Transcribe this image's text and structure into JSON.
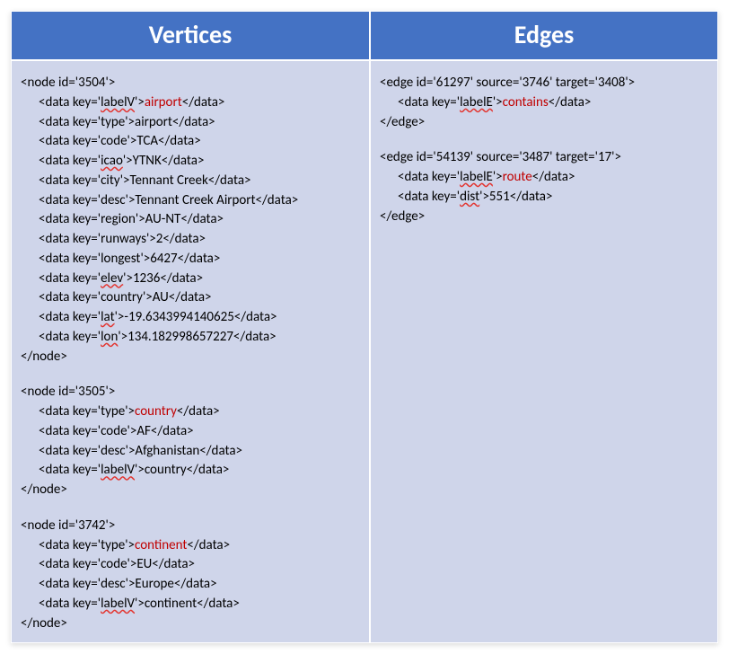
{
  "headers": {
    "vertices": "Vertices",
    "edges": "Edges"
  },
  "vertices": {
    "n1": {
      "open": "<node id='3504'>",
      "d_labelV_pre": "<data key='",
      "d_labelV_key": "labelV",
      "d_labelV_mid": "'>",
      "d_labelV_val": "airport",
      "d_labelV_end": "</data>",
      "d_type": "<data key='type'>airport</data>",
      "d_code": "<data key='code'>TCA</data>",
      "d_icao_pre": "<data key='",
      "d_icao_key": "icao",
      "d_icao_mid": "'>YTNK</data>",
      "d_city": "<data key='city'>Tennant Creek</data>",
      "d_desc": "<data key='desc'>Tennant Creek Airport</data>",
      "d_region": "<data key='region'>AU-NT</data>",
      "d_runways": "<data key='runways'>2</data>",
      "d_longest": "<data key='longest'>6427</data>",
      "d_elev_pre": "<data key='",
      "d_elev_key": "elev",
      "d_elev_mid": "'>1236</data>",
      "d_country": "<data key='country'>AU</data>",
      "d_lat_pre": "<data key='",
      "d_lat_key": "lat",
      "d_lat_mid": "'>-19.6343994140625</data>",
      "d_lon_pre": "<data key='",
      "d_lon_key": "lon",
      "d_lon_mid": "'>134.182998657227</data>",
      "close": "</node>"
    },
    "n2": {
      "open": "<node id='3505'>",
      "d_type_pre": "<data key='type'>",
      "d_type_val": "country",
      "d_type_end": "</data>",
      "d_code": "<data key='code'>AF</data>",
      "d_desc": "<data key='desc'>Afghanistan</data>",
      "d_labelV_pre": "<data key='",
      "d_labelV_key": "labelV",
      "d_labelV_mid": "'>country</data>",
      "close": "</node>"
    },
    "n3": {
      "open": "<node id='3742'>",
      "d_type_pre": "<data key='type'>",
      "d_type_val": "continent",
      "d_type_end": "</data>",
      "d_code": "<data key='code'>EU</data>",
      "d_desc": "<data key='desc'>Europe</data>",
      "d_labelV_pre": "<data key='",
      "d_labelV_key": "labelV",
      "d_labelV_mid": "'>continent</data>",
      "close": "</node>"
    }
  },
  "edges": {
    "e1": {
      "open": "<edge id='61297' source='3746' target='3408'>",
      "d_labelE_pre": "<data key='",
      "d_labelE_key": "labelE",
      "d_labelE_mid": "'>",
      "d_labelE_val": "contains",
      "d_labelE_end": "</data>",
      "close": "</edge>"
    },
    "e2": {
      "open": "<edge id='54139' source='3487' target='17'>",
      "d_labelE_pre": "<data key='",
      "d_labelE_key": "labelE",
      "d_labelE_mid": "'>",
      "d_labelE_val": "route",
      "d_labelE_end": "</data>",
      "d_dist_pre": "<data key='",
      "d_dist_key": "dist",
      "d_dist_mid": "'>551</data>",
      "close": "</edge>"
    }
  }
}
